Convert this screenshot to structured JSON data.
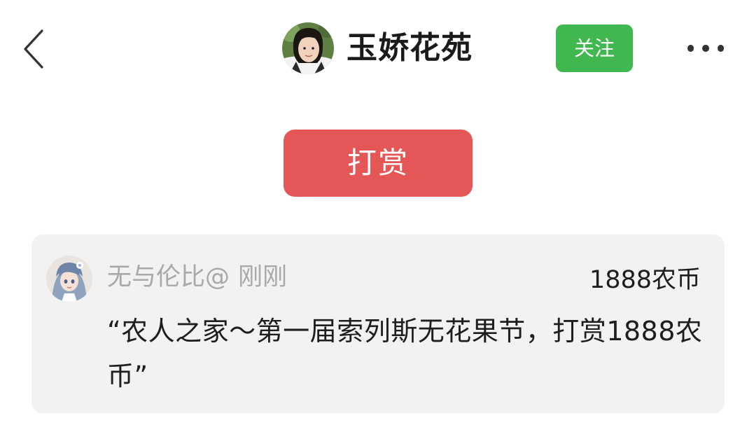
{
  "header": {
    "back_icon": "chevron-left-icon",
    "author_name": "玉娇花苑",
    "follow_label": "关注",
    "more_icon": "more-dots-icon"
  },
  "tip": {
    "button_label": "打赏"
  },
  "tip_record": {
    "tipper_name": "无与伦比@",
    "time": "刚刚",
    "amount": "1888农币",
    "message": "“农人之家～第一届索列斯无花果节，打赏1888农币”"
  },
  "colors": {
    "follow_green": "#41b84f",
    "tip_red": "#e55756",
    "card_bg": "#f2f2f2",
    "muted_text": "#a9a9a9"
  }
}
